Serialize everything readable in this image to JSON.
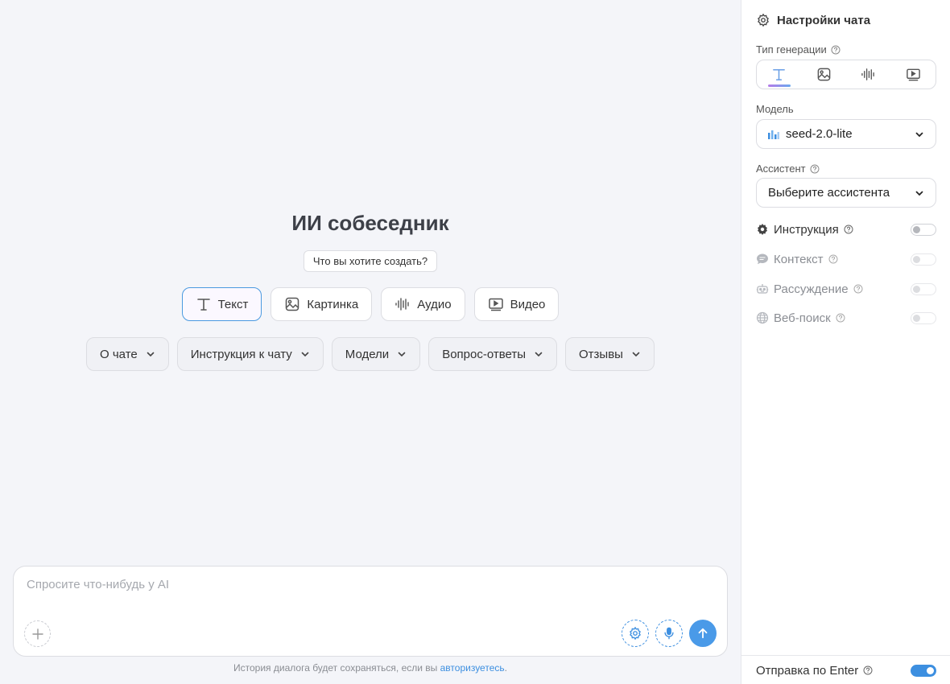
{
  "main": {
    "title": "ИИ собеседник",
    "subtitle": "Что вы хотите создать?",
    "gen_buttons": [
      {
        "label": "Текст",
        "icon": "text-icon",
        "active": true
      },
      {
        "label": "Картинка",
        "icon": "image-icon"
      },
      {
        "label": "Аудио",
        "icon": "audio-wave-icon"
      },
      {
        "label": "Видео",
        "icon": "video-icon"
      }
    ],
    "dropdowns": [
      "О чате",
      "Инструкция к чату",
      "Модели",
      "Вопрос-ответы",
      "Отзывы"
    ],
    "composer": {
      "placeholder": "Спросите что-нибудь у AI",
      "value": ""
    },
    "footnote_text": "История диалога будет сохраняться, если вы ",
    "footnote_link": "авторизуетесь",
    "footnote_end": "."
  },
  "sidebar": {
    "title": "Настройки чата",
    "gen_type_label": "Тип генерации",
    "model_label": "Модель",
    "model_value": "seed-2.0-lite",
    "assistant_label": "Ассистент",
    "assistant_value": "Выберите ассистента",
    "toggles": [
      {
        "label": "Инструкция",
        "icon": "gear-icon",
        "on": false,
        "dim": false
      },
      {
        "label": "Контекст",
        "icon": "chat-bubble-icon",
        "on": false,
        "dim": true
      },
      {
        "label": "Рассуждение",
        "icon": "robot-icon",
        "on": false,
        "dim": true
      },
      {
        "label": "Веб-поиск",
        "icon": "globe-icon",
        "on": false,
        "dim": true
      }
    ],
    "send_on_enter_label": "Отправка по Enter",
    "send_on_enter": true
  },
  "colors": {
    "accent": "#3d8fe0",
    "background": "#f4f5f9"
  }
}
